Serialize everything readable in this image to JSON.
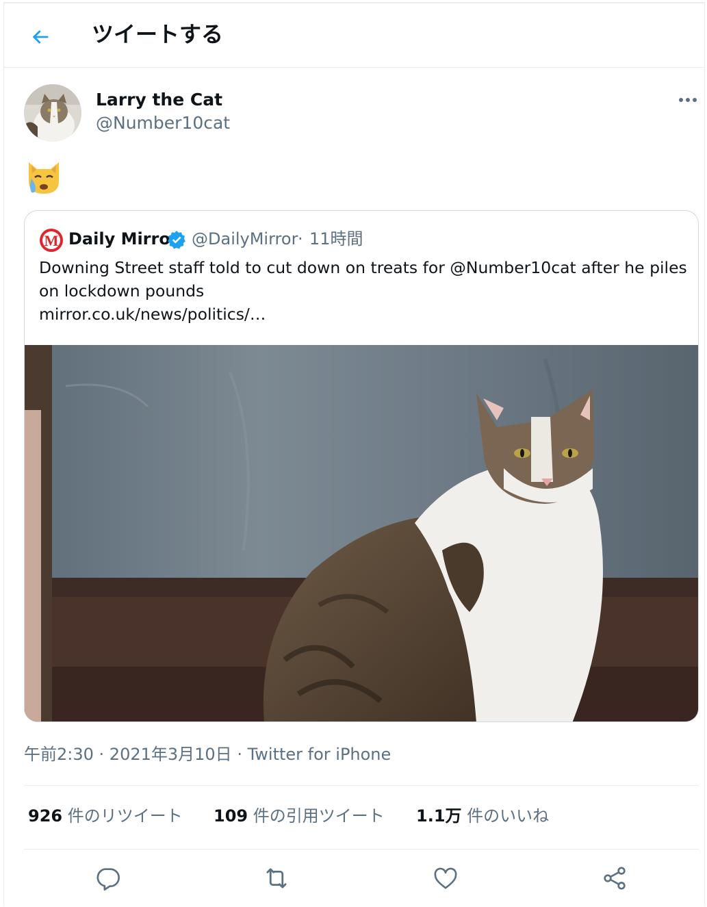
{
  "header": {
    "title": "ツイートする",
    "back_icon": "arrow-left-icon"
  },
  "accent_color": "#1da1f2",
  "tweet": {
    "display_name": "Larry the Cat",
    "handle": "@Number10cat",
    "more_icon": "more-icon",
    "body_emoji": "crying-cat-face-emoji",
    "quoted": {
      "logo_icon": "daily-mirror-logo-icon",
      "display_name": "Daily Mirror",
      "verified_icon": "verified-badge-icon",
      "handle": "@DailyMirror",
      "separator": "·",
      "time": "11時間",
      "text": "Downing Street staff told to cut down on treats for @Number10cat after he piles on lockdown pounds",
      "link": "mirror.co.uk/news/politics/…",
      "image": "tabby-and-white-cat-sitting-by-window-photo"
    },
    "meta": {
      "time": "午前2:30",
      "sep1": " · ",
      "date": "2021年3月10日",
      "sep2": " · ",
      "source": "Twitter for iPhone"
    },
    "stats": {
      "retweets": {
        "count": "926",
        "label": " 件のリツイート"
      },
      "quotes": {
        "count": "109",
        "label": " 件の引用ツイート"
      },
      "likes": {
        "count": "1.1万",
        "label": " 件のいいね"
      }
    },
    "actions": [
      "reply-icon",
      "retweet-icon",
      "like-icon",
      "share-icon"
    ]
  }
}
